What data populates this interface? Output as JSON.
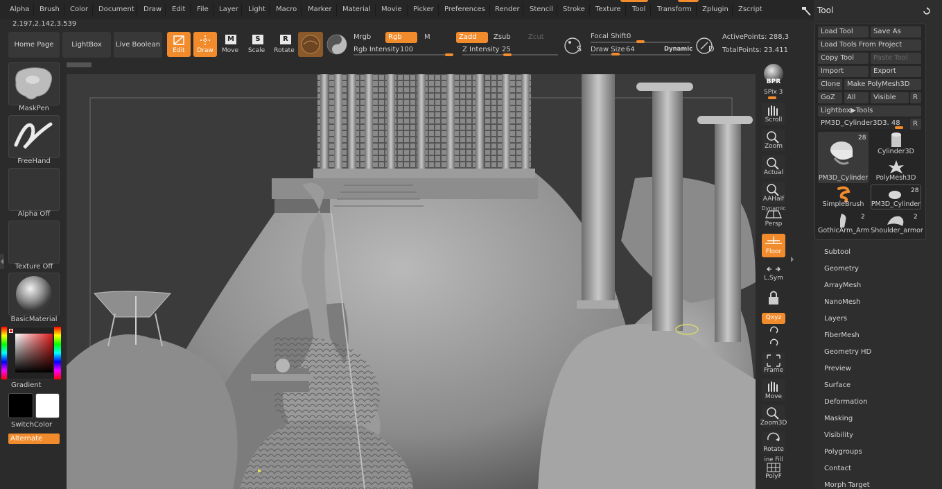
{
  "menu": [
    "Alpha",
    "Brush",
    "Color",
    "Document",
    "Draw",
    "Edit",
    "File",
    "Layer",
    "Light",
    "Macro",
    "Marker",
    "Material",
    "Movie",
    "Picker",
    "Preferences",
    "Render",
    "Stencil",
    "Stroke",
    "Texture",
    "Tool",
    "Transform",
    "Zplugin",
    "Zscript"
  ],
  "coords": "2.197,2.142,3.539",
  "toolbar": {
    "home_page": "Home Page",
    "lightbox": "LightBox",
    "live_boolean": "Live Boolean",
    "edit": "Edit",
    "draw": "Draw",
    "move": "Move",
    "scale": "Scale",
    "rotate": "Rotate",
    "mrgb": "Mrgb",
    "rgb": "Rgb",
    "m": "M",
    "rgb_intensity_label": "Rgb Intensity",
    "rgb_intensity_value": "100",
    "zadd": "Zadd",
    "zsub": "Zsub",
    "zcut": "Zcut",
    "z_intensity_label": "Z Intensity",
    "z_intensity_value": "25",
    "s_label": "S",
    "focal_shift_label": "Focal Shift",
    "focal_shift_value": "0",
    "draw_size_label": "Draw Size",
    "draw_size_value": "64",
    "dynamic": "Dynamic",
    "d_label": "D",
    "active_points": "ActivePoints: 288,3",
    "total_points": "TotalPoints: 23.411"
  },
  "left_shelf": {
    "brush": "MaskPen",
    "stroke": "FreeHand",
    "alpha": "Alpha Off",
    "texture": "Texture Off",
    "material": "BasicMaterial",
    "gradient": "Gradient",
    "switch_color": "SwitchColor",
    "alternate": "Alternate"
  },
  "right_shelf": {
    "bpr": "BPR",
    "spix_label": "SPix",
    "spix_value": "3",
    "scroll": "Scroll",
    "zoom": "Zoom",
    "actual": "Actual",
    "aahalf": "AAHalf",
    "dynamic": "Dynamic",
    "persp": "Persp",
    "floor": "Floor",
    "lsym": "L.Sym",
    "xyz": "Qxyz",
    "frame": "Frame",
    "move": "Move",
    "zoom3d": "Zoom3D",
    "rotate": "Rotate",
    "line_fill": "ine Fill",
    "polyf": "PolyF"
  },
  "tool_panel": {
    "title": "Tool",
    "load_tool": "Load Tool",
    "save_as": "Save As",
    "load_from_project": "Load Tools From Project",
    "copy_tool": "Copy Tool",
    "paste_tool": "Paste Tool",
    "import": "Import",
    "export": "Export",
    "clone": "Clone",
    "make_polymesh": "Make PolyMesh3D",
    "goz": "GoZ",
    "all": "All",
    "visible": "Visible",
    "r": "R",
    "lightbox_tools": "Lightbox▶Tools",
    "current_tool": "PM3D_Cylinder3D3.",
    "current_tool_value": "48",
    "thumbs": [
      {
        "label": "PM3D_Cylinder",
        "count": "28"
      },
      {
        "label": "Cylinder3D",
        "count": ""
      },
      {
        "label": "PolyMesh3D",
        "count": ""
      },
      {
        "label": "SimpleBrush",
        "count": ""
      },
      {
        "label": "PM3D_Cylinder",
        "count": "28"
      },
      {
        "label": "GothicArm_Arm",
        "count": "2"
      },
      {
        "label": "Shoulder_armor",
        "count": "2"
      }
    ],
    "sections": [
      "Subtool",
      "Geometry",
      "ArrayMesh",
      "NanoMesh",
      "Layers",
      "FiberMesh",
      "Geometry HD",
      "Preview",
      "Surface",
      "Deformation",
      "Masking",
      "Visibility",
      "Polygroups",
      "Contact",
      "Morph Target"
    ]
  },
  "colors": {
    "accent": "#f28b2c",
    "background": "#2b2b2b",
    "panel": "#2e2e2e",
    "button": "#383838"
  }
}
